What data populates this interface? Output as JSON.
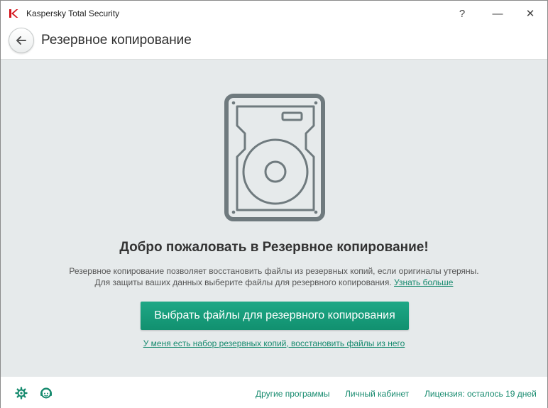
{
  "window": {
    "title": "Kaspersky Total Security",
    "help_glyph": "?",
    "minimize_glyph": "—",
    "close_glyph": "✕"
  },
  "header": {
    "title": "Резервное копирование",
    "back_icon": "arrow-left-icon"
  },
  "main": {
    "welcome_title": "Добро пожаловать в Резервное копирование!",
    "description_line1": "Резервное копирование позволяет восстановить файлы из резервных копий, если оригиналы утеряны.",
    "description_line2": "Для защиты ваших данных выберите файлы для резервного копирования.",
    "learn_more_link": "Узнать больше",
    "primary_button": "Выбрать файлы для резервного копирования",
    "restore_link": "У меня есть набор резервных копий, восстановить файлы из него"
  },
  "footer": {
    "settings_icon": "gear-icon",
    "support_icon": "support-icon",
    "other_programs": "Другие программы",
    "my_account": "Личный кабинет",
    "license": "Лицензия: осталось 19 дней"
  },
  "colors": {
    "accent": "#168a6e",
    "button": "#17a07e",
    "background": "#e6eaeb",
    "icon": "#6f7a7e"
  }
}
